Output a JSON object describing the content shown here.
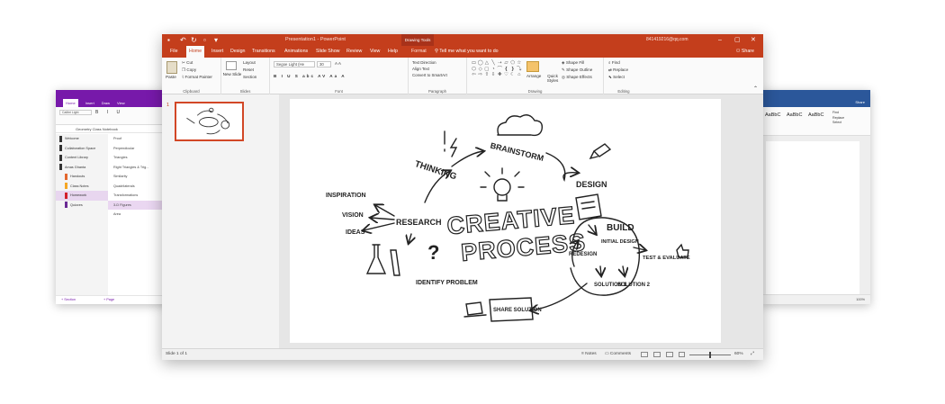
{
  "onenote": {
    "tabs": [
      "Home",
      "Insert",
      "Draw",
      "View"
    ],
    "font_box": "Calibri Light",
    "format_buttons": "B I U",
    "notebook_title": "Geometry Class Notebook",
    "sections": [
      {
        "label": "Welcome",
        "color": "#333333"
      },
      {
        "label": "Collaboration Space",
        "color": "#333333"
      },
      {
        "label": "Content Library",
        "color": "#333333"
      },
      {
        "label": "Amas Ghanta",
        "color": "#333333"
      },
      {
        "label": "Handouts",
        "color": "#e3672e"
      },
      {
        "label": "Class Notes",
        "color": "#f5a623"
      },
      {
        "label": "Homework",
        "color": "#d21e2a"
      },
      {
        "label": "Quizzes",
        "color": "#6b2a94"
      }
    ],
    "pages": [
      "Proof",
      "Perpendicular",
      "Triangles",
      "Right Triangles & Trig...",
      "Similarity",
      "Quadrilaterals",
      "Transformations",
      "3-D Figures",
      "Area"
    ],
    "add_section": "+ Section",
    "add_page": "+ Page"
  },
  "word": {
    "tab": "Share",
    "styles": [
      "AaBbC",
      "AaBbC",
      "AaBbC"
    ],
    "editing": [
      "Find",
      "Replace",
      "Select"
    ],
    "zoom": "100%"
  },
  "powerpoint": {
    "title": "Presentation1 - PowerPoint",
    "contextual_tab": "Drawing Tools",
    "account": "841419216@qq.com",
    "tabs": [
      "File",
      "Home",
      "Insert",
      "Design",
      "Transitions",
      "Animations",
      "Slide Show",
      "Review",
      "View",
      "Help",
      "Format"
    ],
    "tell_me": "Tell me what you want to do",
    "share": "Share",
    "ribbon": {
      "clipboard": {
        "paste": "Paste",
        "cut": "Cut",
        "copy": "Copy",
        "format_painter": "Format Painter",
        "label": "Clipboard"
      },
      "slides": {
        "new_slide": "New Slide",
        "layout": "Layout",
        "reset": "Reset",
        "section": "Section",
        "label": "Slides"
      },
      "font": {
        "font_name": "Segoe Light (He",
        "font_size": "30",
        "label": "Font",
        "format_row": "B I U S abc AV Aa A"
      },
      "paragraph": {
        "text_direction": "Text Direction",
        "align_text": "Align Text",
        "smartart": "Convert to SmartArt",
        "label": "Paragraph"
      },
      "drawing": {
        "arrange": "Arrange",
        "quick_styles": "Quick Styles",
        "shape_fill": "Shape Fill",
        "shape_outline": "Shape Outline",
        "shape_effects": "Shape Effects",
        "label": "Drawing"
      },
      "editing": {
        "find": "Find",
        "replace": "Replace",
        "select": "Select",
        "label": "Editing"
      }
    },
    "slide_number": "1",
    "slide_content": {
      "title_line1": "CREATIVE",
      "title_line2": "PROCESS",
      "thinking": "THINKING",
      "brainstorm": "BRAINSTORM",
      "design": "DESIGN",
      "build": "BUILD",
      "initial_design": "INITIAL DESIGN",
      "test_evaluate": "TEST & EVALUATE",
      "redesign": "REDESIGN",
      "solution1": "SOLUTION 1",
      "solution2": "SOLUTION 2",
      "share_solution": "SHARE SOLUTION",
      "identify_problem": "IDENTIFY PROBLEM",
      "research": "RESEARCH",
      "inspiration": "INSPIRATION",
      "vision": "VISION",
      "ideas": "IDEAS"
    },
    "status": {
      "slide_of": "Slide 1 of 1",
      "notes": "Notes",
      "comments": "Comments",
      "zoom": "60%"
    }
  },
  "colors": {
    "ppt_accent": "#c43e1c",
    "onenote_accent": "#7719aa",
    "word_accent": "#2b579a"
  }
}
